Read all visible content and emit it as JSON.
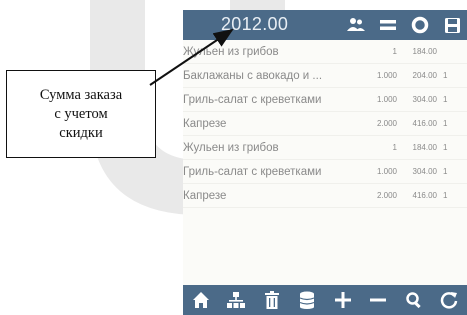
{
  "callout": {
    "text": "Сумма заказа\nс учетом\nскидки"
  },
  "header": {
    "total": "2012.00"
  },
  "top_icons": [
    "users-icon",
    "equals-icon",
    "gear-icon",
    "save-icon"
  ],
  "order_items": [
    {
      "name": "Жульен из грибов",
      "qty": "1",
      "sum": "184.00",
      "num": ""
    },
    {
      "name": "Баклажаны с авокадо и ...",
      "qty": "1.000",
      "sum": "204.00",
      "num": "1"
    },
    {
      "name": "Гриль-салат с креветками",
      "qty": "1.000",
      "sum": "304.00",
      "num": "1"
    },
    {
      "name": "Капрезе",
      "qty": "2.000",
      "sum": "416.00",
      "num": "1"
    },
    {
      "name": "Жульен из грибов",
      "qty": "1",
      "sum": "184.00",
      "num": "1"
    },
    {
      "name": "Гриль-салат с креветками",
      "qty": "1.000",
      "sum": "304.00",
      "num": "1"
    },
    {
      "name": "Капрезе",
      "qty": "2.000",
      "sum": "416.00",
      "num": "1"
    }
  ],
  "bottom_icons": [
    "home-icon",
    "network-icon",
    "trash-icon",
    "database-icon",
    "plus-icon",
    "minus-icon",
    "search-icon",
    "refresh-icon"
  ],
  "colors": {
    "bar": "#4b6a88",
    "icon": "#ffffff",
    "text": "#8a8a8a"
  }
}
